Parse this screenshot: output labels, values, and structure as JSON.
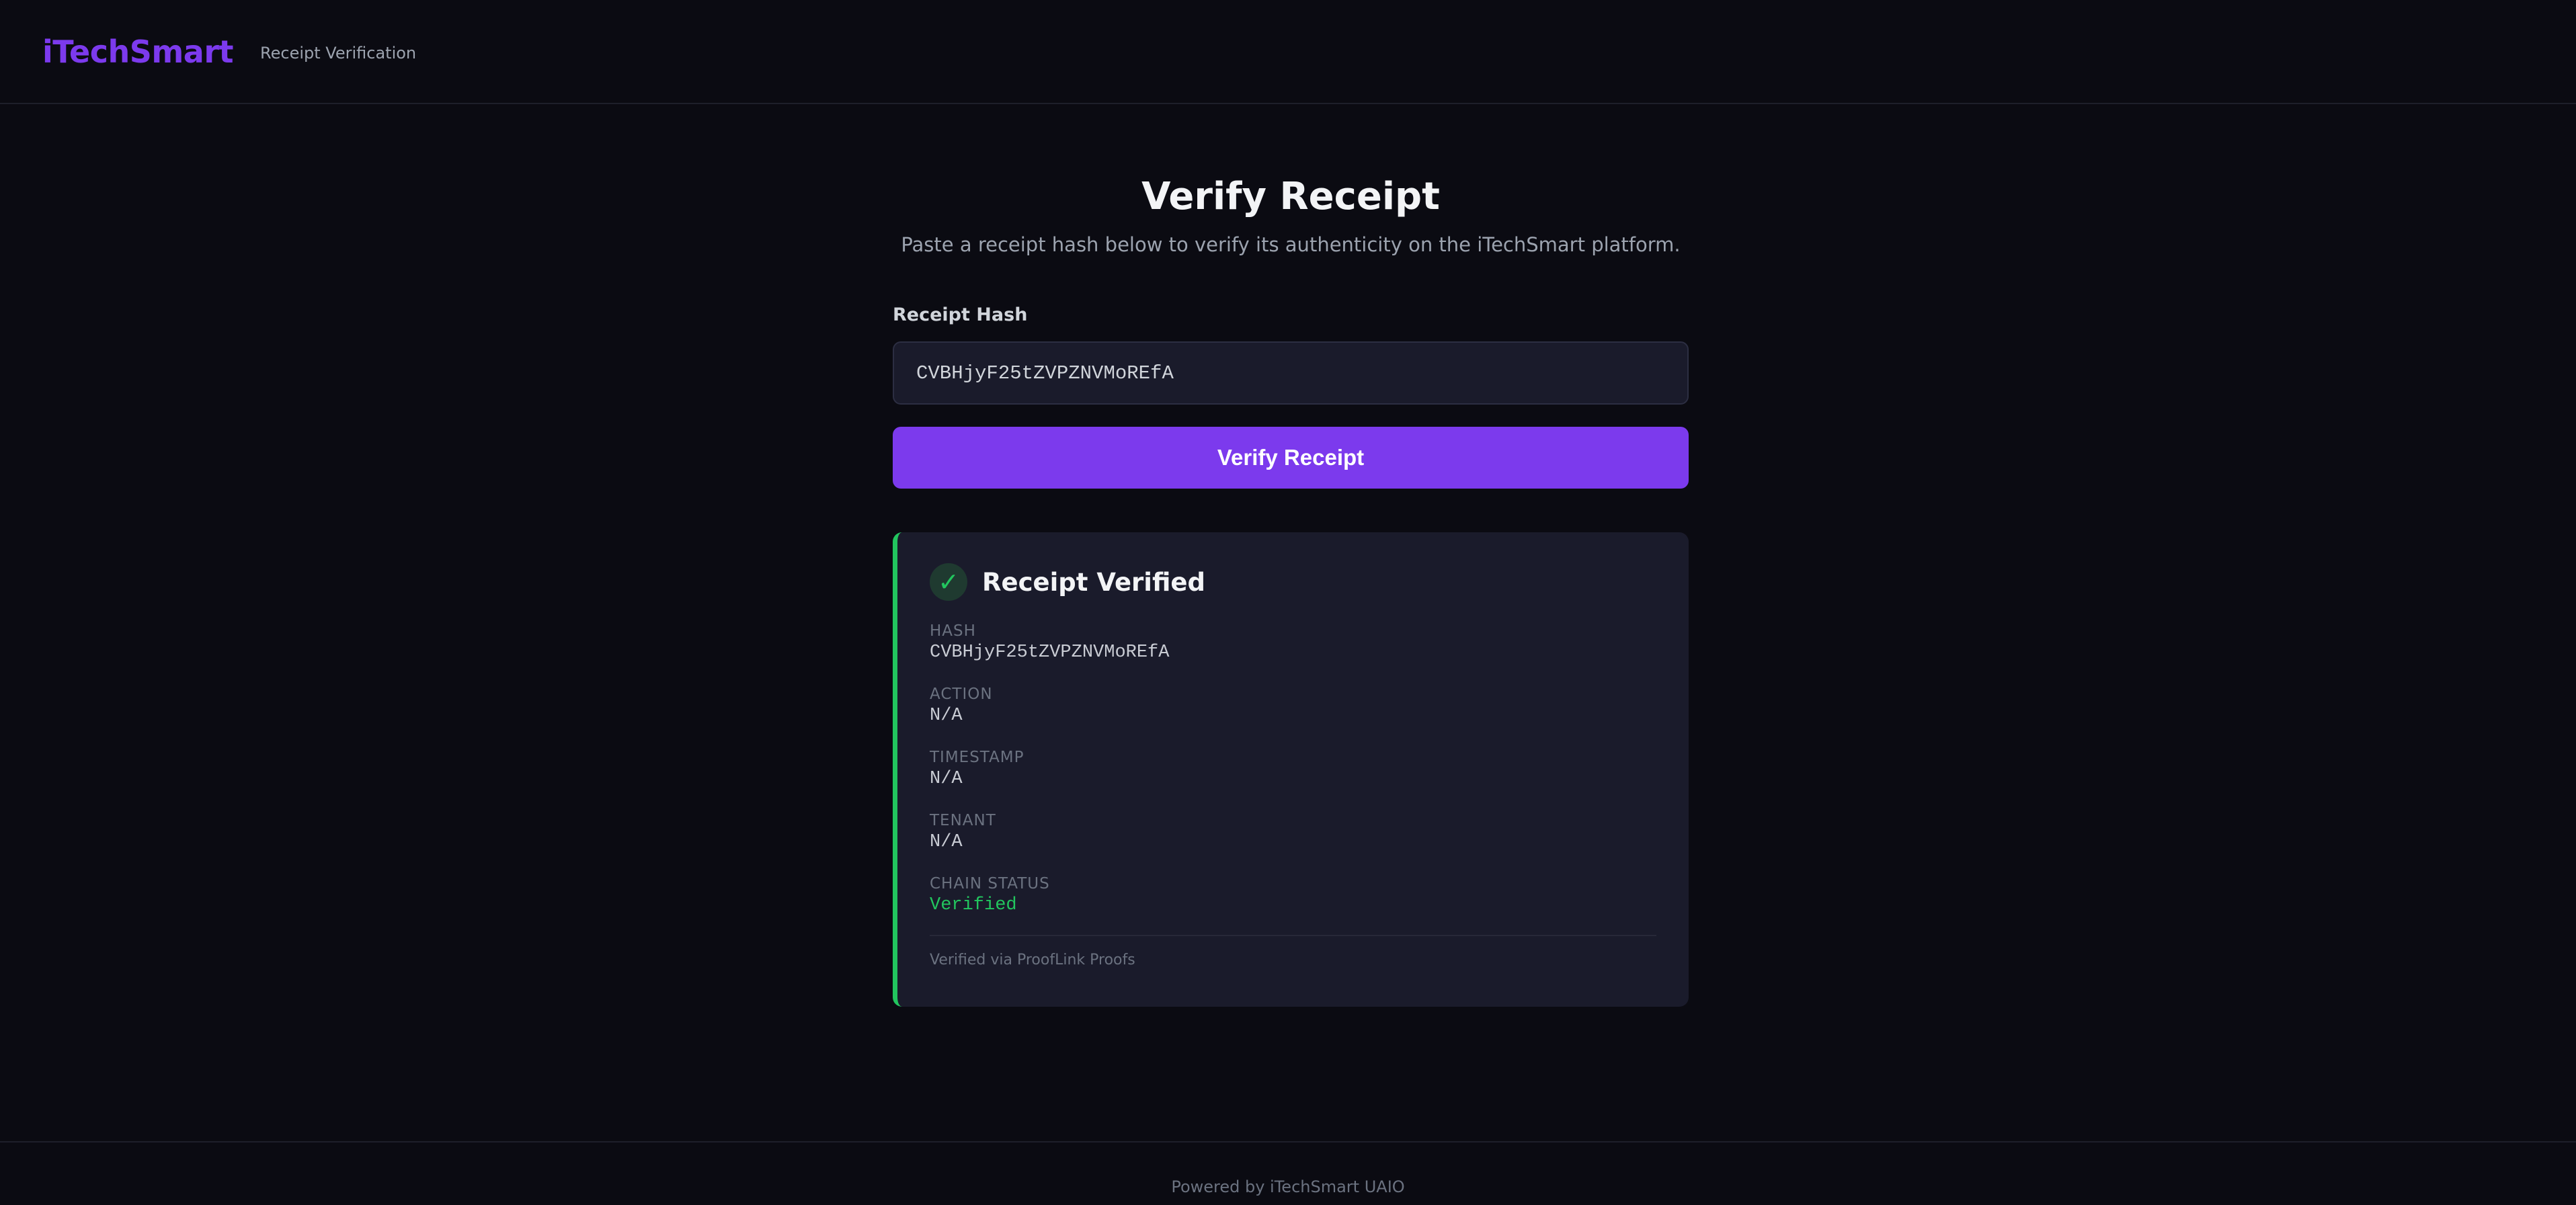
{
  "header": {
    "brand": "iTechSmart",
    "subtitle": "Receipt Verification"
  },
  "main": {
    "title": "Verify Receipt",
    "description": "Paste a receipt hash below to verify its authenticity on the iTechSmart platform.",
    "hash_label": "Receipt Hash",
    "hash_value": "CVBHjyF25tZVPZNVMoREfA",
    "verify_button_label": "Verify Receipt"
  },
  "result": {
    "check_glyph": "✓",
    "title": "Receipt Verified",
    "fields": [
      {
        "key": "HASH",
        "value": "CVBHjyF25tZVPZNVMoREfA"
      },
      {
        "key": "ACTION",
        "value": "N/A"
      },
      {
        "key": "TIMESTAMP",
        "value": "N/A"
      },
      {
        "key": "TENANT",
        "value": "N/A"
      },
      {
        "key": "CHAIN STATUS",
        "value": "Verified"
      }
    ],
    "footer_note": "Verified via ProofLink Proofs"
  },
  "footer": {
    "powered_by": "Powered by iTechSmart UAIO"
  },
  "colors": {
    "accent": "#7c3aed",
    "success": "#22c55e",
    "background": "#0b0b12",
    "card": "#1a1b2b"
  },
  "icons": {
    "verified": "check-icon"
  }
}
